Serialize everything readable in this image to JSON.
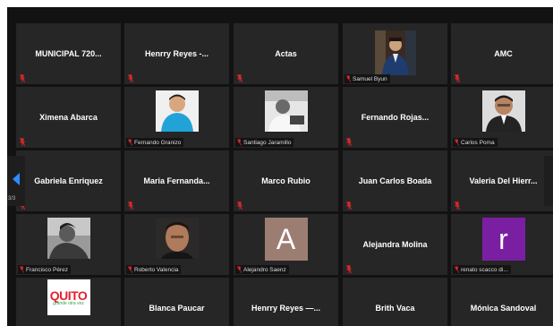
{
  "pagination": {
    "indicator": "3/3"
  },
  "colors": {
    "stage_bg": "#121212",
    "tile_bg": "#262626",
    "mic_muted": "#e02828",
    "arrow": "#2d8cff",
    "avatar_A": "#9c7d72",
    "avatar_r": "#7b1fa2"
  },
  "tiles": [
    {
      "name": "MUNICIPAL 720..."
    },
    {
      "name": "Henrry Reyes -..."
    },
    {
      "name": "Actas"
    },
    {
      "name": "Samuel Byun"
    },
    {
      "name": "AMC"
    },
    {
      "name": "Ximena Abarca"
    },
    {
      "name": "Fernando Granizo"
    },
    {
      "name": "Santiago Jaramillo"
    },
    {
      "name": "Fernando Rojas..."
    },
    {
      "name": "Carlos Poma"
    },
    {
      "name": "Gabriela Enriquez"
    },
    {
      "name": "Maria Fernanda..."
    },
    {
      "name": "Marco Rubio"
    },
    {
      "name": "Juan Carlos Boada"
    },
    {
      "name": "Valeria Del Hierr..."
    },
    {
      "name": "Francisco Pérez"
    },
    {
      "name": "Roberto Valencia"
    },
    {
      "name": "Alejandro Saenz",
      "avatar_letter": "A"
    },
    {
      "name": "Alejandra Molina"
    },
    {
      "name": "renato scacco di...",
      "avatar_letter": "r"
    },
    {
      "name": "",
      "logo_text": "QUITO",
      "logo_sub": "grande otra vez"
    },
    {
      "name": "Blanca Paucar"
    },
    {
      "name": "Henrry Reyes —..."
    },
    {
      "name": "Brith Vaca"
    },
    {
      "name": "Mónica Sandoval"
    }
  ]
}
